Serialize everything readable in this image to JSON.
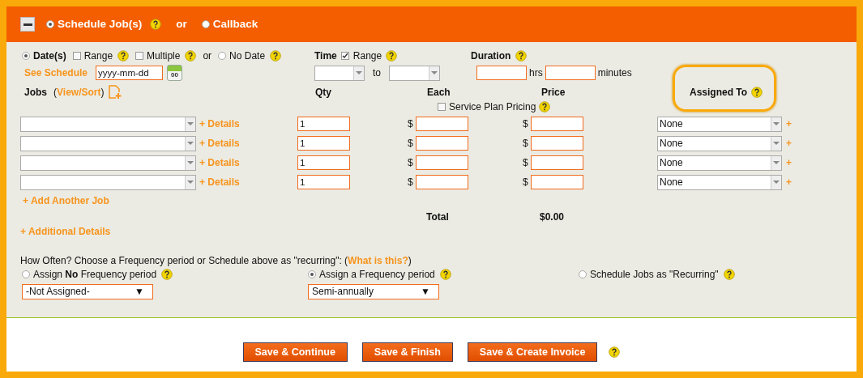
{
  "header": {
    "options": [
      {
        "label": "Schedule Job(s)",
        "selected": true,
        "help": true
      },
      {
        "label": "Callback",
        "selected": false,
        "help": false
      }
    ],
    "separator": "or"
  },
  "date_options": [
    {
      "kind": "radio",
      "label": "Date(s)",
      "selected": true,
      "help": false
    },
    {
      "kind": "checkbox",
      "label": "Range",
      "checked": false,
      "help": true
    },
    {
      "kind": "checkbox",
      "label": "Multiple",
      "checked": false,
      "help": true
    },
    {
      "kind": "text",
      "label": "or",
      "help": false
    },
    {
      "kind": "radio",
      "label": "No Date",
      "selected": false,
      "help": true
    }
  ],
  "see_schedule": "See Schedule",
  "date_field": {
    "value": "yyyy-mm-dd"
  },
  "calendar_label": "00",
  "time": {
    "label": "Time",
    "range": {
      "label": "Range",
      "checked": true
    },
    "to": "to"
  },
  "duration": {
    "label": "Duration",
    "hrs": "hrs",
    "minutes": "minutes"
  },
  "jobs_header": {
    "label": "Jobs",
    "view_sort_open": "(",
    "view_sort": "View/Sort",
    "view_sort_close": ")",
    "qty": "Qty",
    "each": "Each",
    "price": "Price",
    "assigned_to": "Assigned To",
    "service_plan": {
      "label": "Service Plan Pricing",
      "checked": false
    }
  },
  "job_rows": [
    {
      "details": "+ Details",
      "qty": "1",
      "each_currency": "$",
      "price_currency": "$",
      "assigned": "None",
      "add": "+"
    },
    {
      "details": "+ Details",
      "qty": "1",
      "each_currency": "$",
      "price_currency": "$",
      "assigned": "None",
      "add": "+"
    },
    {
      "details": "+ Details",
      "qty": "1",
      "each_currency": "$",
      "price_currency": "$",
      "assigned": "None",
      "add": "+"
    },
    {
      "details": "+ Details",
      "qty": "1",
      "each_currency": "$",
      "price_currency": "$",
      "assigned": "None",
      "add": "+"
    }
  ],
  "add_job": "+ Add Another Job",
  "total_label": "Total",
  "total_value": "$0.00",
  "additional_details": "+ Additional Details",
  "frequency": {
    "prompt": "How Often? Choose a Frequency period or Schedule above as \"recurring\": (",
    "link": "What is this?",
    "prompt_end": ")",
    "options": [
      {
        "label": "Assign **No** Frequency period",
        "selected": false,
        "select": "-Not Assigned-",
        "arrow": "▼"
      },
      {
        "label": "Assign a Frequency period",
        "selected": true,
        "select": "Semi-annually",
        "arrow": "▼"
      },
      {
        "label": "Schedule Jobs as \"Recurring\"",
        "selected": false
      }
    ]
  },
  "buttons": [
    "Save & Continue",
    "Save & Finish",
    "Save & Create Invoice"
  ]
}
